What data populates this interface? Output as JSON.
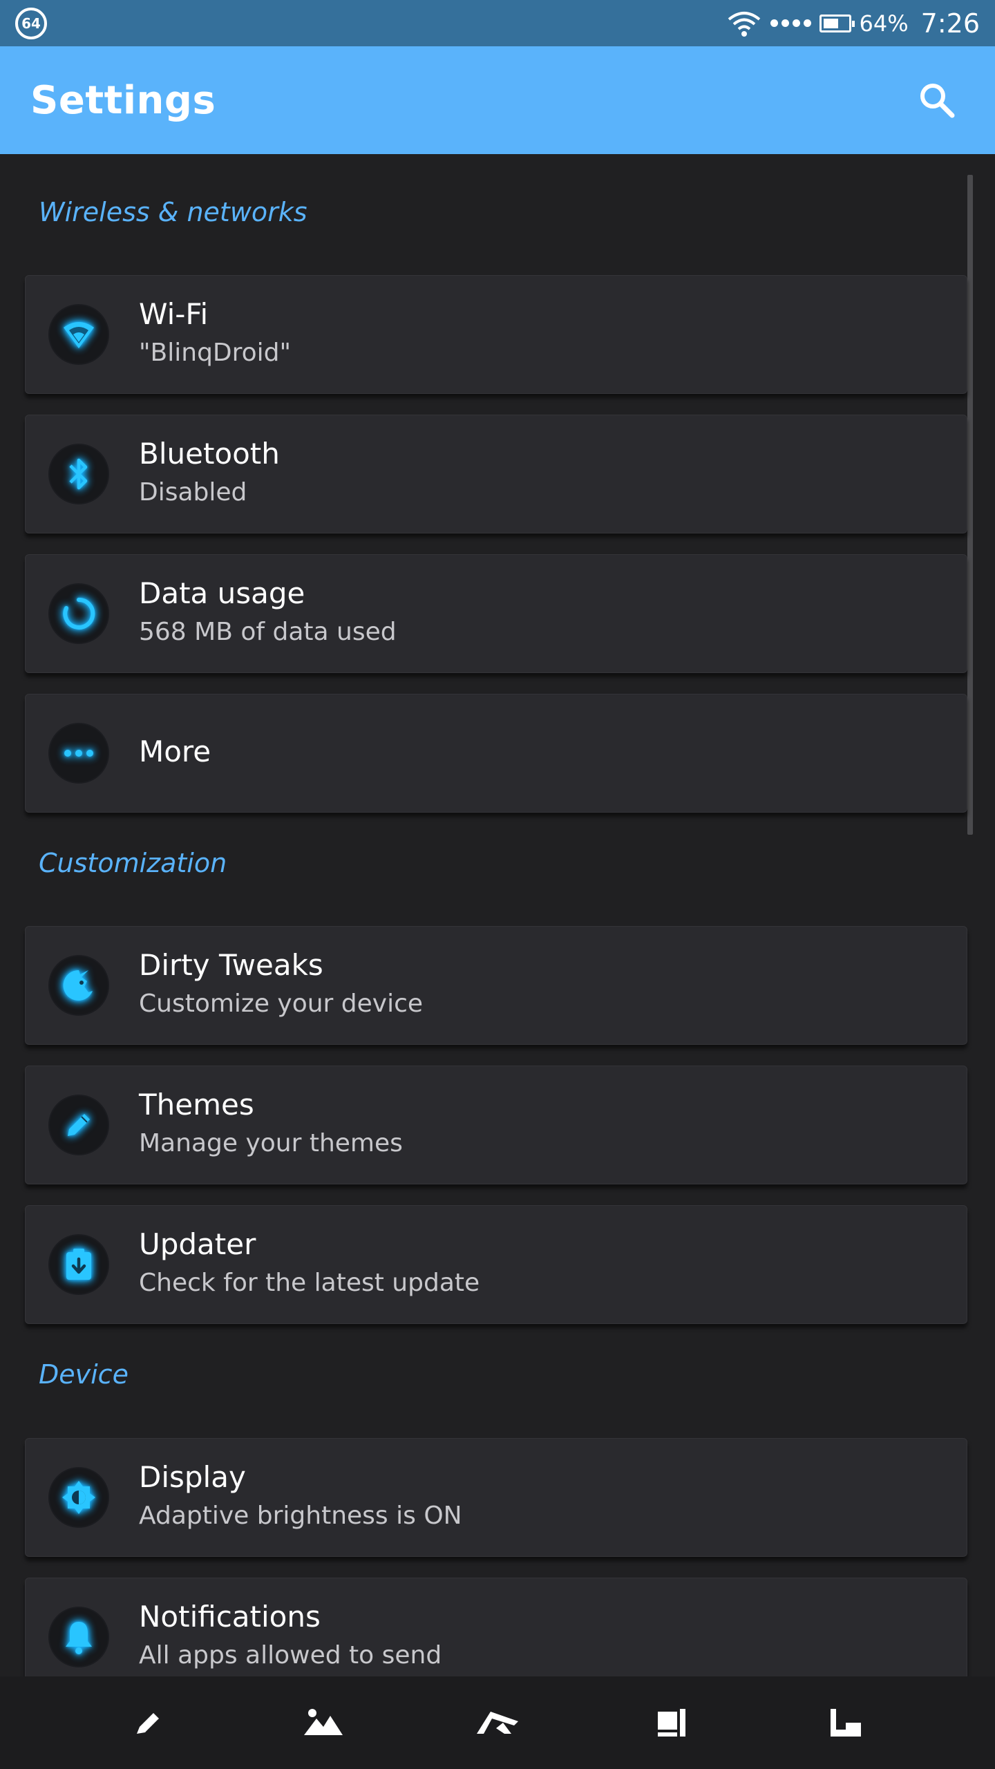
{
  "status_bar": {
    "badge": "64",
    "battery_percent": "64%",
    "time": "7:26"
  },
  "app_bar": {
    "title": "Settings",
    "search_icon": "search-icon"
  },
  "sections": [
    {
      "header": "Wireless & networks",
      "items": [
        {
          "icon": "wifi-icon",
          "title": "Wi-Fi",
          "subtitle": "\"BlinqDroid\""
        },
        {
          "icon": "bluetooth-icon",
          "title": "Bluetooth",
          "subtitle": "Disabled"
        },
        {
          "icon": "data-usage-icon",
          "title": "Data usage",
          "subtitle": "568 MB of data used"
        },
        {
          "icon": "more-icon",
          "title": "More",
          "subtitle": ""
        }
      ]
    },
    {
      "header": "Customization",
      "items": [
        {
          "icon": "unicorn-icon",
          "title": "Dirty Tweaks",
          "subtitle": "Customize your device"
        },
        {
          "icon": "pencil-icon",
          "title": "Themes",
          "subtitle": "Manage your themes"
        },
        {
          "icon": "updater-icon",
          "title": "Updater",
          "subtitle": "Check for the latest update"
        }
      ]
    },
    {
      "header": "Device",
      "items": [
        {
          "icon": "brightness-icon",
          "title": "Display",
          "subtitle": "Adaptive brightness is ON"
        },
        {
          "icon": "bell-icon",
          "title": "Notifications",
          "subtitle": "All apps allowed to send"
        }
      ]
    }
  ],
  "bottom_nav": [
    "back-icon",
    "gallery-icon",
    "home-icon",
    "recents-icon",
    "corner-icon"
  ],
  "colors": {
    "status_bar": "#35709b",
    "app_bar": "#5ab3fb",
    "background": "#202022",
    "card": "#2a2a2e",
    "accent": "#5ab3fb",
    "icon_glow": "#18b4ff"
  }
}
